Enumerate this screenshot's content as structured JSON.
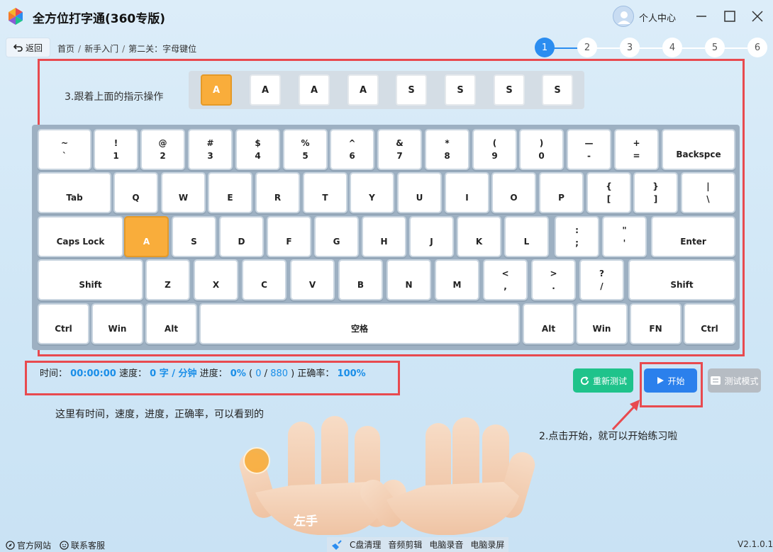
{
  "app": {
    "title": "全方位打字通(360专版)"
  },
  "user": {
    "label": "个人中心"
  },
  "nav": {
    "back_label": "返回",
    "breadcrumb": [
      "首页",
      "新手入门",
      "第二关：字母键位"
    ]
  },
  "steps": [
    "1",
    "2",
    "3",
    "4",
    "5",
    "6"
  ],
  "instruction": {
    "label": "3.跟着上面的指示操作",
    "sequence": [
      "A",
      "A",
      "A",
      "A",
      "S",
      "S",
      "S",
      "S"
    ]
  },
  "keyboard": {
    "row1": [
      {
        "top": "~",
        "bottom": "`"
      },
      {
        "top": "!",
        "bottom": "1"
      },
      {
        "top": "@",
        "bottom": "2"
      },
      {
        "top": "#",
        "bottom": "3"
      },
      {
        "top": "$",
        "bottom": "4"
      },
      {
        "top": "%",
        "bottom": "5"
      },
      {
        "top": "^",
        "bottom": "6"
      },
      {
        "top": "&",
        "bottom": "7"
      },
      {
        "top": "*",
        "bottom": "8"
      },
      {
        "top": "(",
        "bottom": "9"
      },
      {
        "top": ")",
        "bottom": "0"
      },
      {
        "top": "—",
        "bottom": "-"
      },
      {
        "top": "+",
        "bottom": "="
      },
      {
        "top": "",
        "bottom": "Backspce"
      }
    ],
    "row2": [
      {
        "top": "",
        "bottom": "Tab"
      },
      {
        "top": "",
        "bottom": "Q"
      },
      {
        "top": "",
        "bottom": "W"
      },
      {
        "top": "",
        "bottom": "E"
      },
      {
        "top": "",
        "bottom": "R"
      },
      {
        "top": "",
        "bottom": "T"
      },
      {
        "top": "",
        "bottom": "Y"
      },
      {
        "top": "",
        "bottom": "U"
      },
      {
        "top": "",
        "bottom": "I"
      },
      {
        "top": "",
        "bottom": "O"
      },
      {
        "top": "",
        "bottom": "P"
      },
      {
        "top": "{",
        "bottom": "["
      },
      {
        "top": "}",
        "bottom": "]"
      },
      {
        "top": "|",
        "bottom": "\\"
      }
    ],
    "row3": [
      {
        "top": "",
        "bottom": "Caps Lock"
      },
      {
        "top": "",
        "bottom": "A"
      },
      {
        "top": "",
        "bottom": "S"
      },
      {
        "top": "",
        "bottom": "D"
      },
      {
        "top": "",
        "bottom": "F"
      },
      {
        "top": "",
        "bottom": "G"
      },
      {
        "top": "",
        "bottom": "H"
      },
      {
        "top": "",
        "bottom": "J"
      },
      {
        "top": "",
        "bottom": "K"
      },
      {
        "top": "",
        "bottom": "L"
      },
      {
        "top": ":",
        "bottom": ";"
      },
      {
        "top": "\"",
        "bottom": "'"
      },
      {
        "top": "",
        "bottom": "Enter"
      }
    ],
    "row4": [
      {
        "top": "",
        "bottom": "Shift"
      },
      {
        "top": "",
        "bottom": "Z"
      },
      {
        "top": "",
        "bottom": "X"
      },
      {
        "top": "",
        "bottom": "C"
      },
      {
        "top": "",
        "bottom": "V"
      },
      {
        "top": "",
        "bottom": "B"
      },
      {
        "top": "",
        "bottom": "N"
      },
      {
        "top": "",
        "bottom": "M"
      },
      {
        "top": "<",
        "bottom": ","
      },
      {
        "top": ">",
        "bottom": "."
      },
      {
        "top": "?",
        "bottom": "/"
      },
      {
        "top": "",
        "bottom": "Shift"
      }
    ],
    "row5": [
      {
        "top": "",
        "bottom": "Ctrl"
      },
      {
        "top": "",
        "bottom": "Win"
      },
      {
        "top": "",
        "bottom": "Alt"
      },
      {
        "top": "",
        "bottom": "空格"
      },
      {
        "top": "",
        "bottom": "Alt"
      },
      {
        "top": "",
        "bottom": "Win"
      },
      {
        "top": "",
        "bottom": "FN"
      },
      {
        "top": "",
        "bottom": "Ctrl"
      }
    ],
    "highlight_key": "A"
  },
  "stats": {
    "time_label": "时间：",
    "time_value": "00:00:00",
    "speed_label": "速度：",
    "speed_value": "0 字 / 分钟",
    "progress_label": "进度：",
    "progress_pct": "0%",
    "progress_open": "(",
    "progress_done": "0",
    "progress_slash": "/",
    "progress_total": "880",
    "progress_close": ")",
    "accuracy_label": "正确率：",
    "accuracy_value": "100%"
  },
  "buttons": {
    "retest": "重新测试",
    "start": "开始",
    "test_mode": "测试模式"
  },
  "hints": {
    "stats_hint": "这里有时间，速度，进度，正确率，可以看到的",
    "start_hint": "2.点击开始，就可以开始练习啦"
  },
  "hands": {
    "left_label": "左手"
  },
  "footer": {
    "official_site": "官方网站",
    "support": "联系客服",
    "tools": [
      "C盘清理",
      "音频剪辑",
      "电脑录音",
      "电脑录屏"
    ],
    "version": "V2.1.0.1"
  },
  "colors": {
    "accent": "#2b8df0",
    "highlight": "#f9ad3b",
    "annotation_red": "#e84a4f",
    "stat_blue": "#1a8ee8",
    "retest_green": "#1fc38b"
  }
}
